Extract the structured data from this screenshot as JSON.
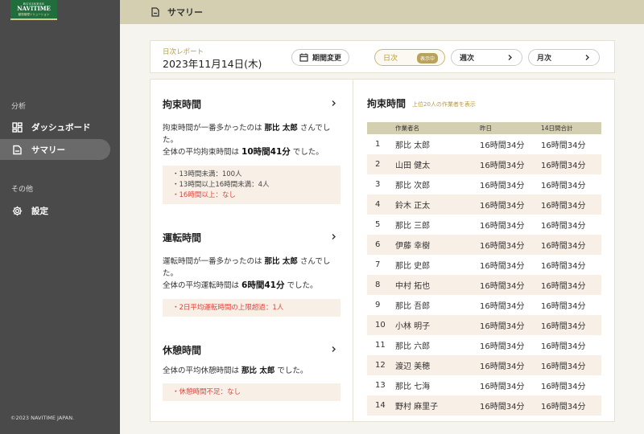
{
  "logo": {
    "line1": "BUSINESS",
    "line2": "NAVITIME",
    "line3": "動態管理ソリューション"
  },
  "sidebar": {
    "section_analysis": "分析",
    "items": [
      {
        "label": "ダッシュボード",
        "icon": "dashboard-icon"
      },
      {
        "label": "サマリー",
        "icon": "document-icon",
        "active": true
      }
    ],
    "section_other": "その他",
    "settings_label": "設定",
    "copyright": "©2023 NAVITIME JAPAN."
  },
  "topbar": {
    "title": "サマリー"
  },
  "report": {
    "label": "日次レポート",
    "date": "2023年11月14日(木)",
    "period_button": "期間変更",
    "tabs": [
      {
        "label": "日次",
        "badge": "表示中",
        "active": true
      },
      {
        "label": "週次"
      },
      {
        "label": "月次"
      }
    ]
  },
  "sections": {
    "restraint": {
      "title": "拘束時間",
      "line1_pre": "拘束時間が一番多かったのは ",
      "line1_name": "那比 太郎",
      "line1_post": " さんでした。",
      "line2_pre": "全体の平均拘束時間は ",
      "line2_value": "10時間41分",
      "line2_post": " でした。",
      "bullets": [
        "13時間未満：100人",
        "13時間以上16時間未満：4人"
      ],
      "alert": "16時間以上：なし"
    },
    "driving": {
      "title": "運転時間",
      "line1_pre": "運転時間が一番多かったのは ",
      "line1_name": "那比 太郎",
      "line1_post": " さんでした。",
      "line2_pre": "全体の平均運転時間は ",
      "line2_value": "6時間41分",
      "line2_post": " でした。",
      "alert": "2日平均運転時間の上限超過：1人"
    },
    "rest": {
      "title": "休憩時間",
      "line1_pre": "全体の平均休憩時間は ",
      "line1_name": "那比 太郎",
      "line1_post": " でした。",
      "alert": "休憩時間不足：なし"
    }
  },
  "ranking": {
    "title": "拘束時間",
    "subtitle": "上位20人の作業者を表示",
    "columns": [
      "",
      "作業者名",
      "昨日",
      "14日間合計"
    ],
    "rows": [
      {
        "no": "1",
        "name": "那比 太郎",
        "yesterday": "16時間34分",
        "total": "16時間34分"
      },
      {
        "no": "2",
        "name": "山田 健太",
        "yesterday": "16時間34分",
        "total": "16時間34分"
      },
      {
        "no": "3",
        "name": "那比 次郎",
        "yesterday": "16時間34分",
        "total": "16時間34分"
      },
      {
        "no": "4",
        "name": "鈴木 正太",
        "yesterday": "16時間34分",
        "total": "16時間34分"
      },
      {
        "no": "5",
        "name": "那比 三郎",
        "yesterday": "16時間34分",
        "total": "16時間34分"
      },
      {
        "no": "6",
        "name": "伊藤 幸樹",
        "yesterday": "16時間34分",
        "total": "16時間34分"
      },
      {
        "no": "7",
        "name": "那比 史郎",
        "yesterday": "16時間34分",
        "total": "16時間34分"
      },
      {
        "no": "8",
        "name": "中村 拓也",
        "yesterday": "16時間34分",
        "total": "16時間34分"
      },
      {
        "no": "9",
        "name": "那比 吾郎",
        "yesterday": "16時間34分",
        "total": "16時間34分"
      },
      {
        "no": "10",
        "name": "小林 明子",
        "yesterday": "16時間34分",
        "total": "16時間34分"
      },
      {
        "no": "11",
        "name": "那比 六郎",
        "yesterday": "16時間34分",
        "total": "16時間34分"
      },
      {
        "no": "12",
        "name": "渡辺 美穂",
        "yesterday": "16時間34分",
        "total": "16時間34分"
      },
      {
        "no": "13",
        "name": "那比 七海",
        "yesterday": "16時間34分",
        "total": "16時間34分"
      },
      {
        "no": "14",
        "name": "野村 麻里子",
        "yesterday": "16時間34分",
        "total": "16時間34分"
      }
    ]
  },
  "colors": {
    "sidebar": "#4a4a4a",
    "topbar": "#d5cfb1",
    "accent": "#b79a3a",
    "alert": "#e0463c",
    "row_alt": "#f8efe6"
  }
}
